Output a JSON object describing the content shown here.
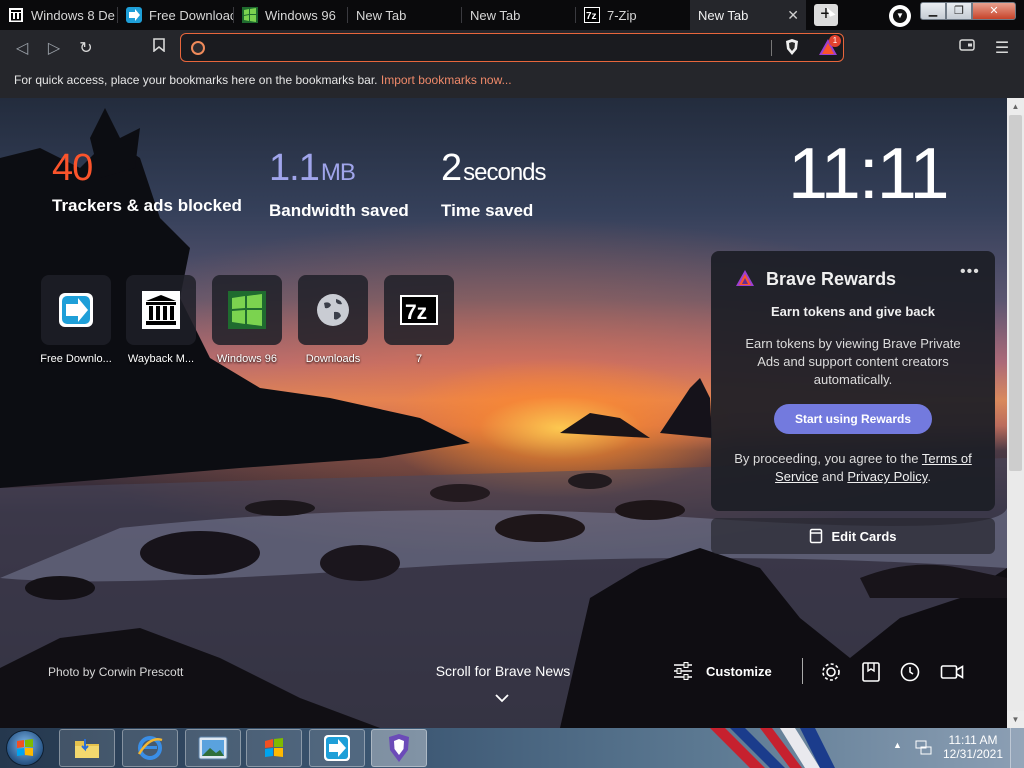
{
  "tabs": [
    {
      "label": "Windows 8 De",
      "icon": "archive-icon"
    },
    {
      "label": "Free Downloac",
      "icon": "arrow-app-icon"
    },
    {
      "label": "Windows 96",
      "icon": "windows96-icon"
    },
    {
      "label": "New Tab",
      "icon": ""
    },
    {
      "label": "New Tab",
      "icon": ""
    },
    {
      "label": "7-Zip",
      "icon": "7zip-icon"
    },
    {
      "label": "New Tab",
      "icon": "",
      "active": true
    }
  ],
  "toolbar": {
    "url_value": "",
    "rewards_badge": "1"
  },
  "bookmarks_bar": {
    "text": "For quick access, place your bookmarks here on the bookmarks bar.",
    "link": "Import bookmarks now..."
  },
  "stats": {
    "trackers_value": "40",
    "trackers_label": "Trackers & ads blocked",
    "bandwidth_value": "1.1",
    "bandwidth_unit": "MB",
    "bandwidth_label": "Bandwidth saved",
    "time_value": "2",
    "time_unit": "seconds",
    "time_label": "Time saved"
  },
  "clock": "11:11",
  "top_sites": [
    {
      "name": "Free Downlo...",
      "icon": "arrow-app-icon"
    },
    {
      "name": "Wayback M...",
      "icon": "archive-icon"
    },
    {
      "name": "Windows 96",
      "icon": "windows96-icon"
    },
    {
      "name": "Downloads",
      "icon": "globe-icon"
    },
    {
      "name": "7",
      "icon": "7zip-icon"
    }
  ],
  "rewards": {
    "title": "Brave Rewards",
    "subtitle": "Earn tokens and give back",
    "description": "Earn tokens by viewing Brave Private Ads and support content creators automatically.",
    "button": "Start using Rewards",
    "legal_prefix": "By proceeding, you agree to the",
    "terms": "Terms of Service",
    "and": "and",
    "privacy": "Privacy Policy",
    "period": "."
  },
  "edit_cards": "Edit Cards",
  "photo_credit": "Photo by Corwin Prescott",
  "news_label": "Scroll for Brave News",
  "customize_label": "Customize",
  "taskbar": {
    "time": "11:11 AM",
    "date": "12/31/2021"
  },
  "colors": {
    "brave_orange": "#fb542b",
    "rewards_purple": "#737ade",
    "url_border": "#e8663c"
  }
}
